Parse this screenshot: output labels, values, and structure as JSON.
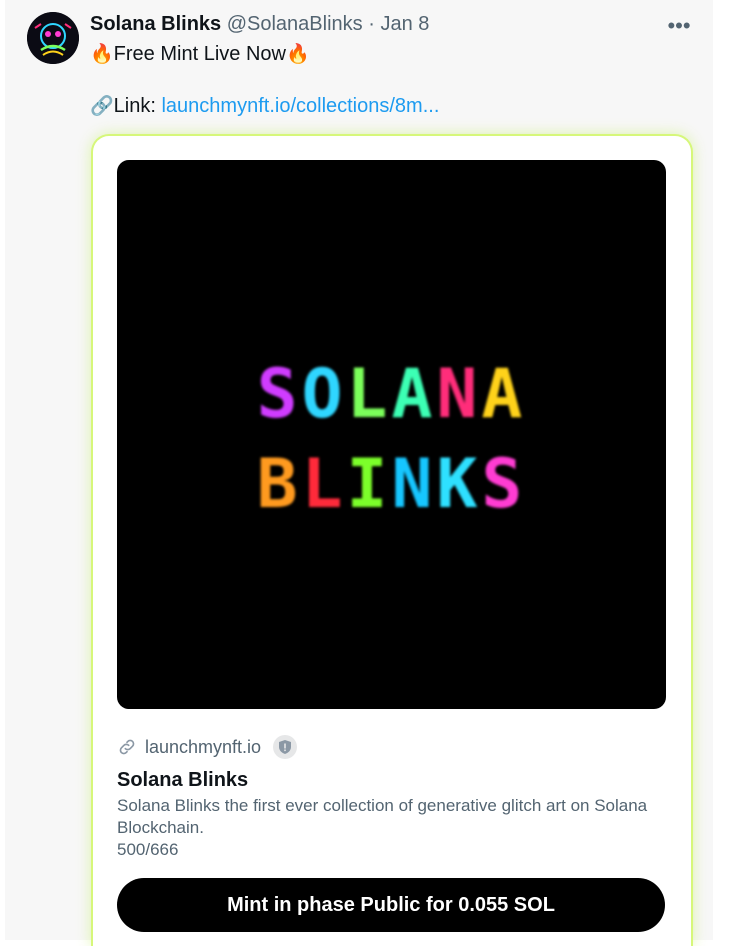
{
  "tweet": {
    "author_name": "Solana Blinks",
    "author_handle": "@SolanaBlinks",
    "separator": "·",
    "date": "Jan 8",
    "line1_emoji_left": "🔥",
    "line1_text": "Free Mint Live Now",
    "line1_emoji_right": "🔥",
    "link_emoji": "🔗",
    "link_label": "Link: ",
    "link_text": "launchmynft.io/collections/8m...",
    "more_icon": "more-horizontal-icon"
  },
  "card": {
    "image_text_row1": [
      "S",
      "O",
      "L",
      "A",
      "N",
      "A"
    ],
    "image_text_row2": [
      "B",
      "L",
      "I",
      "N",
      "K",
      "S"
    ],
    "glitch_colors_row1": [
      "#d03cff",
      "#2fd6ff",
      "#7bff5a",
      "#3cffb4",
      "#ff2d7a",
      "#ffd21a"
    ],
    "glitch_colors_row2": [
      "#ff9a1f",
      "#ff2a3a",
      "#7cff2a",
      "#16c6ff",
      "#2ee0ff",
      "#ff3cd2"
    ],
    "domain": "launchmynft.io",
    "title": "Solana Blinks",
    "description": "Solana Blinks the first ever collection of generative glitch art on Solana Blockchain.",
    "supply": "500/666",
    "button_label": "Mint in phase Public for 0.055 SOL"
  },
  "colors": {
    "link": "#1d9bf0",
    "secondary_text": "#536471",
    "card_glow_border": "#d6f77a"
  }
}
